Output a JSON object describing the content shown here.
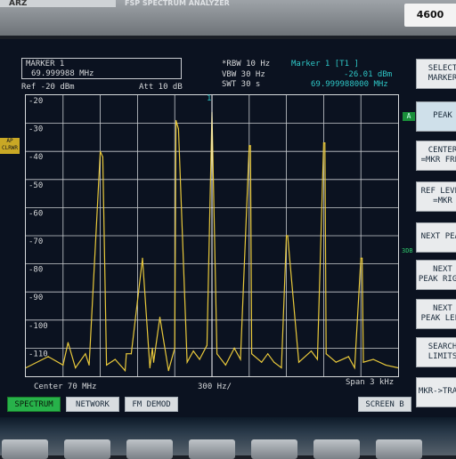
{
  "bezel": {
    "brand": "ARZ",
    "model": "FSP SPECTRUM ANALYZER",
    "tag": "4600"
  },
  "marker_readout": {
    "title": "MARKER 1",
    "frequency": "69.999988 MHz"
  },
  "settings": {
    "ref_level": "Ref -20 dBm",
    "attenuation": "Att  10 dB",
    "rbw": "*RBW 10 Hz",
    "vbw": "VBW 30 Hz",
    "swt": "SWT 30 s",
    "marker_header": "Marker 1 [T1 ]",
    "marker_level": "-26.01 dBm",
    "marker_freq": "69.999988000 MHz"
  },
  "chart_data": {
    "type": "line",
    "xlabel": "",
    "ylabel": "",
    "x_center_label": "Center 70 MHz",
    "x_div_label": "300 Hz/",
    "x_span_label": "Span 3 kHz",
    "ylim": [
      -120,
      -20
    ],
    "yticks": [
      "-20",
      "-30",
      "-40",
      "-50",
      "-60",
      "-70",
      "-80",
      "-90",
      "-100",
      "-110"
    ],
    "xlim": [
      -1500,
      1500
    ],
    "grid": true,
    "x": [
      -1500,
      -1320,
      -1200,
      -1160,
      -1100,
      -1020,
      -990,
      -900,
      -880,
      -850,
      -780,
      -700,
      -690,
      -650,
      -560,
      -500,
      -480,
      -470,
      -420,
      -350,
      -300,
      -290,
      -270,
      -200,
      -150,
      -100,
      -40,
      0,
      40,
      110,
      180,
      230,
      300,
      310,
      320,
      400,
      450,
      500,
      560,
      600,
      610,
      700,
      800,
      850,
      900,
      910,
      920,
      1000,
      1100,
      1150,
      1200,
      1210,
      1220,
      1300,
      1400,
      1500
    ],
    "values": [
      -117,
      -113,
      -116,
      -108,
      -117,
      -112,
      -116,
      -40,
      -42,
      -116,
      -114,
      -118,
      -112,
      -112,
      -78,
      -117,
      -110,
      -115,
      -99,
      -118,
      -110,
      -29,
      -32,
      -115,
      -111,
      -114,
      -109,
      -26,
      -112,
      -116,
      -110,
      -114,
      -38,
      -38,
      -112,
      -115,
      -112,
      -115,
      -117,
      -70,
      -70,
      -115,
      -111,
      -114,
      -37,
      -37,
      -112,
      -115,
      -113,
      -117,
      -78,
      -78,
      -115,
      -114,
      -116,
      -117
    ],
    "trace_color": "#e8c83b",
    "marker": {
      "label": "1",
      "x": 0,
      "y": -26.01
    }
  },
  "side_labels": {
    "left_tag": "AP CLRWR",
    "trace_tag": "A",
    "range_tag": "3DB"
  },
  "softkeys": [
    {
      "line1": "SELECT",
      "line2": "MARKER"
    },
    {
      "line1": "PEAK",
      "line2": ""
    },
    {
      "line1": "CENTER",
      "line2": "=MKR FREQ"
    },
    {
      "line1": "REF LEVEL",
      "line2": "=MKR"
    },
    {
      "line1": "NEXT PEAK",
      "line2": ""
    },
    {
      "line1": "NEXT",
      "line2": "PEAK RIGHT"
    },
    {
      "line1": "NEXT",
      "line2": "PEAK LEFT"
    },
    {
      "line1": "SEARCH",
      "line2": "LIMITS"
    },
    {
      "line1": "MKR->TRACE",
      "line2": ""
    }
  ],
  "tabs": [
    {
      "label": "SPECTRUM"
    },
    {
      "label": "NETWORK"
    },
    {
      "label": "FM DEMOD"
    },
    {
      "label": "SCREEN B"
    }
  ]
}
